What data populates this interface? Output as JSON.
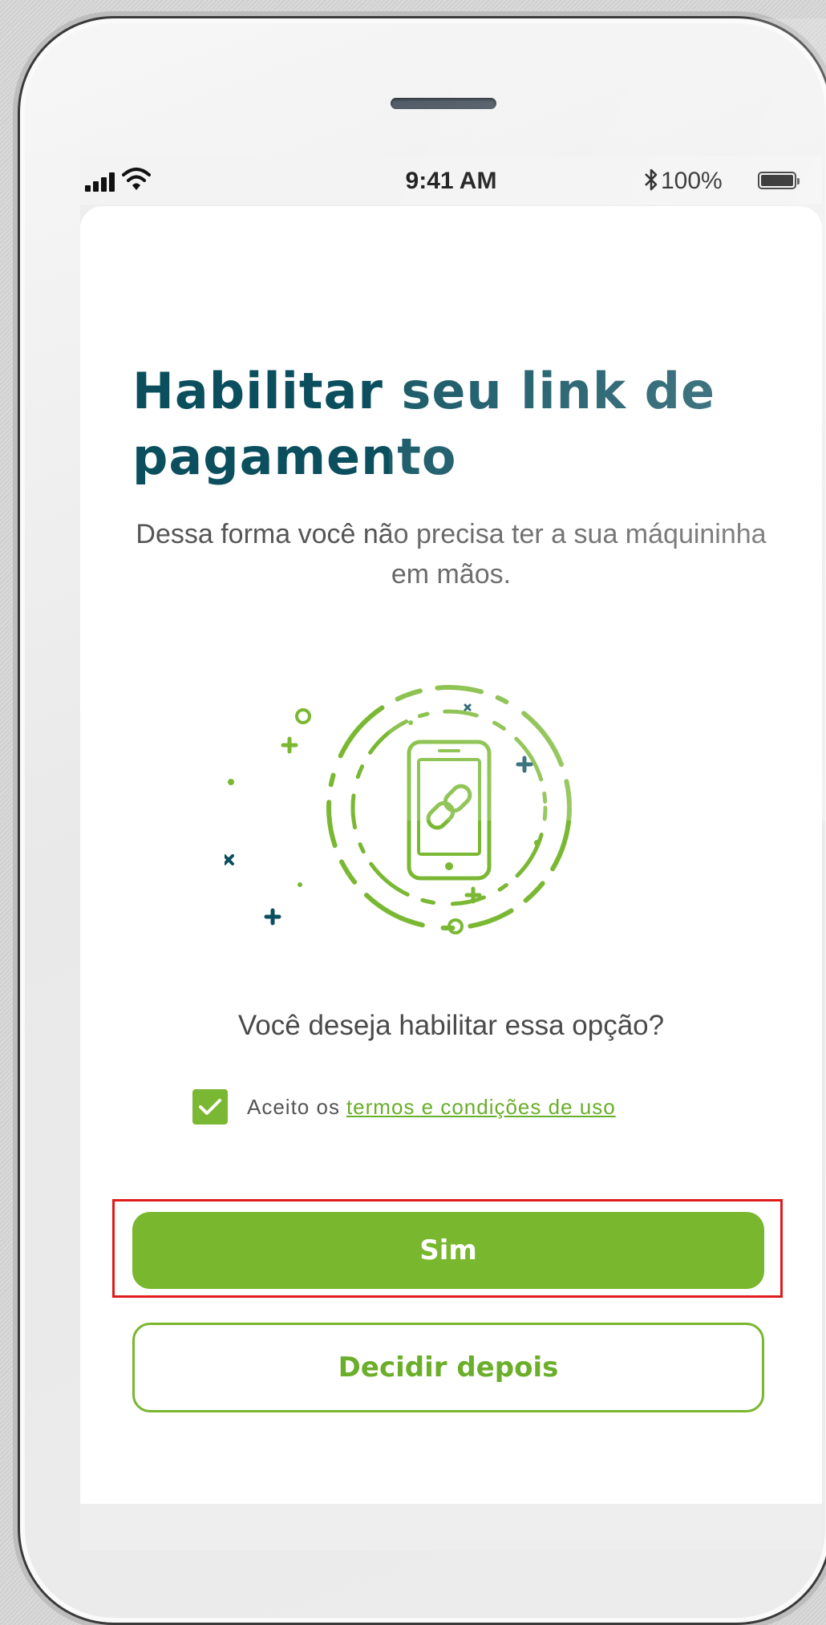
{
  "status_bar": {
    "time": "9:41 AM",
    "battery": "100%",
    "signal_icon": "cellular-signal-icon",
    "wifi_icon": "wifi-icon",
    "bluetooth_icon": "bluetooth-icon",
    "battery_icon": "battery-full-icon"
  },
  "screen": {
    "title": "Habilitar seu link de pagamento",
    "subtitle": "Dessa forma você não precisa ter a sua máquininha em mãos.",
    "illustration_icon": "phone-link-icon",
    "question": "Você deseja habilitar essa opção?",
    "terms": {
      "checked": true,
      "prefix": "Aceito os",
      "link_text": "termos e condições de uso"
    },
    "primary_button": "Sim",
    "secondary_button": "Decidir depois"
  },
  "colors": {
    "title": "#0b4f5e",
    "accent_green": "#78b72e",
    "highlight_red": "#e01b1b"
  }
}
